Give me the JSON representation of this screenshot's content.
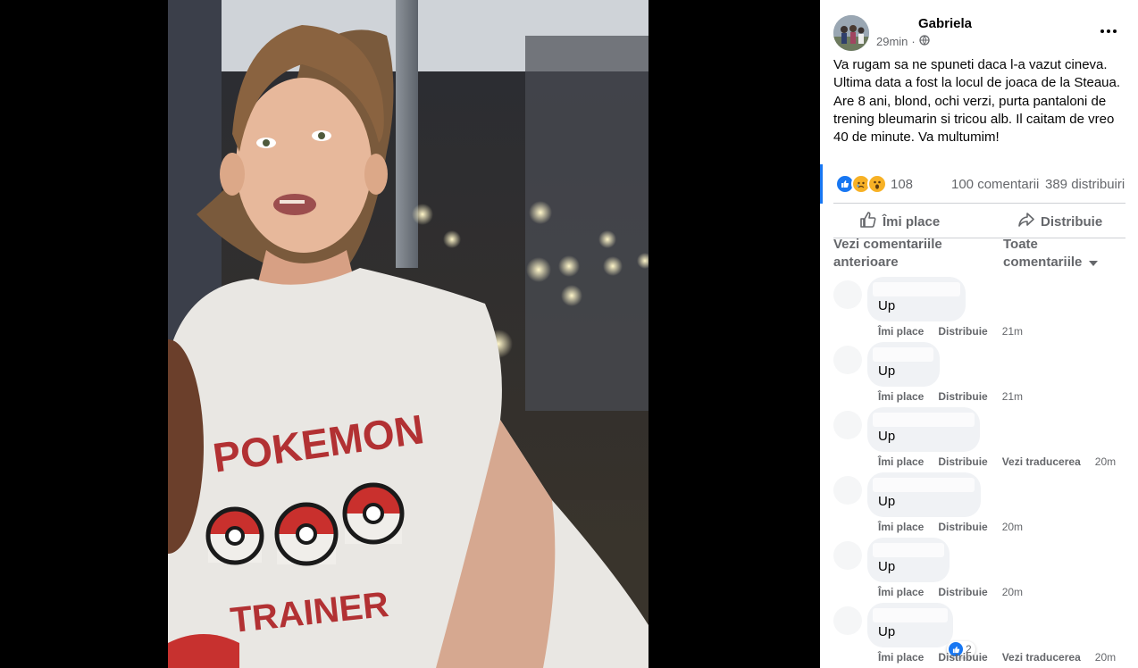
{
  "post": {
    "author": "Gabriela",
    "time": "29min",
    "dot": "·",
    "privacy_icon": "globe-icon",
    "more_icon": "more-options-icon",
    "text": "Va rugam sa ne spuneti daca l-a vazut cineva. Ultima data a fost la locul de joaca de la Steaua. Are 8 ani, blond, ochi verzi, purta pantaloni de trening bleumarin si tricou alb. Il caitam de vreo 40 de minute. Va multumim!",
    "reaction_icons": [
      "like-reaction-icon",
      "sad-reaction-icon",
      "wow-reaction-icon"
    ],
    "reaction_count": "108",
    "comments_count": "100 comentarii",
    "shares_count": "389 distribuiri"
  },
  "actions": {
    "like_label": "Îmi place",
    "share_label": "Distribuie"
  },
  "comments_header": {
    "previous_label": "Vezi comentariile anterioare",
    "filter_label": "Toate comentariile"
  },
  "photo": {
    "shirt_text_top": "POKEMON",
    "shirt_text_bottom": "TRAINER"
  },
  "comments": [
    {
      "text": "Up",
      "like": "Îmi place",
      "share": "Distribuie",
      "translate": "",
      "time": "21m"
    },
    {
      "text": "Up",
      "like": "Îmi place",
      "share": "Distribuie",
      "translate": "",
      "time": "21m"
    },
    {
      "text": "Up",
      "like": "Îmi place",
      "share": "Distribuie",
      "translate": "Vezi traducerea",
      "time": "20m"
    },
    {
      "text": "Up",
      "like": "Îmi place",
      "share": "Distribuie",
      "translate": "",
      "time": "20m"
    },
    {
      "text": "Up",
      "like": "Îmi place",
      "share": "Distribuie",
      "translate": "",
      "time": "20m"
    },
    {
      "text": "Up",
      "like": "Îmi place",
      "share": "Distribuie",
      "translate": "Vezi traducerea",
      "time": "20m",
      "reaction_count": "2"
    }
  ],
  "colors": {
    "accent": "#1877f2",
    "muted": "#65676b",
    "bubble": "#f0f2f5"
  }
}
